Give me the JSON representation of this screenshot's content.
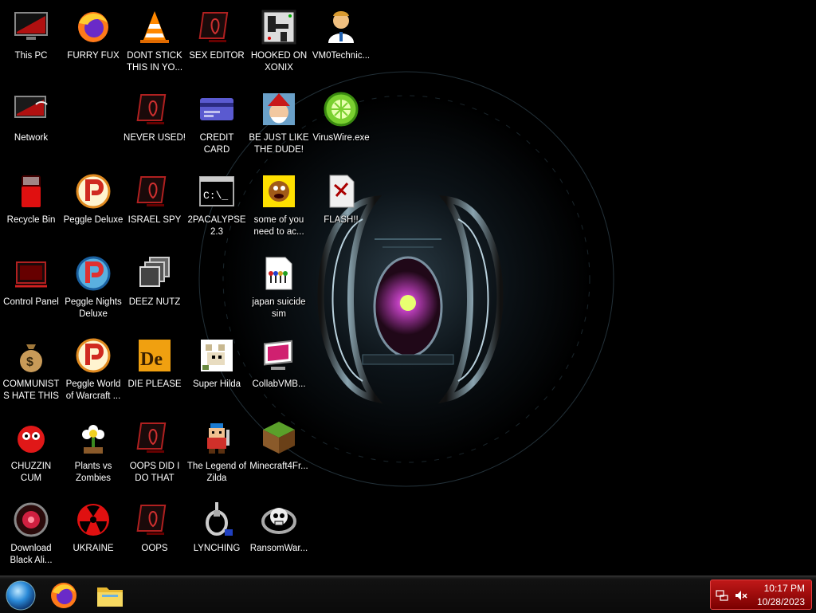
{
  "desktop": {
    "icons": [
      {
        "label": "This PC",
        "icon": "computer-icon"
      },
      {
        "label": "FURRY FUX",
        "icon": "firefox-icon"
      },
      {
        "label": "DONT STICK THIS IN YO...",
        "icon": "vlc-cone-icon"
      },
      {
        "label": "SEX EDITOR",
        "icon": "alienware-monitor-icon"
      },
      {
        "label": "HOOKED ON XONIX",
        "icon": "xonix-game-icon"
      },
      {
        "label": "VM0Technic...",
        "icon": "technician-icon"
      },
      {
        "label": "Network",
        "icon": "network-icon"
      },
      {
        "label": "NEVER USED!",
        "icon": "alienware-monitor-icon"
      },
      {
        "label": "CREDIT CARD CHECKER",
        "icon": "credit-card-icon"
      },
      {
        "label": "BE JUST LIKE THE DUDE!",
        "icon": "santa-elf-icon"
      },
      {
        "label": "VirusWire.exe",
        "icon": "limewire-icon"
      },
      {
        "label": "Recycle Bin",
        "icon": "recycle-bin-icon"
      },
      {
        "label": "Peggle Deluxe",
        "icon": "peggle-icon"
      },
      {
        "label": "ISRAEL SPY",
        "icon": "alienware-monitor-icon"
      },
      {
        "label": "2PACALYPSE 2.3",
        "icon": "command-prompt-icon"
      },
      {
        "label": "some of you need to ac...",
        "icon": "cartoon-dog-icon"
      },
      {
        "label": "FLASH!!",
        "icon": "shortcut-file-icon"
      },
      {
        "label": "Control Panel",
        "icon": "control-panel-icon"
      },
      {
        "label": "Peggle Nights Deluxe",
        "icon": "peggle-nights-icon"
      },
      {
        "label": "DEEZ NUTZ",
        "icon": "stacked-windows-icon"
      },
      {
        "label": "japan suicide sim",
        "icon": "document-icon"
      },
      {
        "label": "COMMUNISTS HATE THIS G...",
        "icon": "money-bag-icon"
      },
      {
        "label": "Peggle World of Warcraft ...",
        "icon": "peggle-icon"
      },
      {
        "label": "DIE PLEASE",
        "icon": "de-logo-icon"
      },
      {
        "label": "Super Hilda",
        "icon": "pixel-dog-icon"
      },
      {
        "label": "CollabVMB...",
        "icon": "collabvm-icon"
      },
      {
        "label": "CHUZZIN CUM",
        "icon": "chuzzle-icon"
      },
      {
        "label": "Plants vs Zombies",
        "icon": "flower-icon"
      },
      {
        "label": "OOPS DID I DO THAT",
        "icon": "alienware-monitor-icon"
      },
      {
        "label": "The Legend of Zilda",
        "icon": "pixel-hero-icon"
      },
      {
        "label": "Minecraft4Fr...",
        "icon": "minecraft-block-icon"
      },
      {
        "label": "Download Black Ali...",
        "icon": "alien-orb-icon"
      },
      {
        "label": "UKRAINE",
        "icon": "radiation-icon"
      },
      {
        "label": "OOPS",
        "icon": "alienware-monitor-icon"
      },
      {
        "label": "LYNCHING",
        "icon": "noose-icon"
      },
      {
        "label": "RansomWar...",
        "icon": "skull-ring-icon"
      }
    ]
  },
  "taskbar": {
    "buttons": [
      {
        "name": "start",
        "icon": "start-orb-icon"
      },
      {
        "name": "firefox",
        "icon": "firefox-icon"
      },
      {
        "name": "file-explorer",
        "icon": "folder-icon"
      }
    ],
    "tray": {
      "time": "10:17 PM",
      "date": "10/28/2023",
      "icons": [
        "network-status-icon",
        "volume-muted-icon"
      ]
    }
  },
  "colors": {
    "accent": "#c01818",
    "desktop_background": "#000000",
    "taskbar": "#0a0a0a"
  }
}
